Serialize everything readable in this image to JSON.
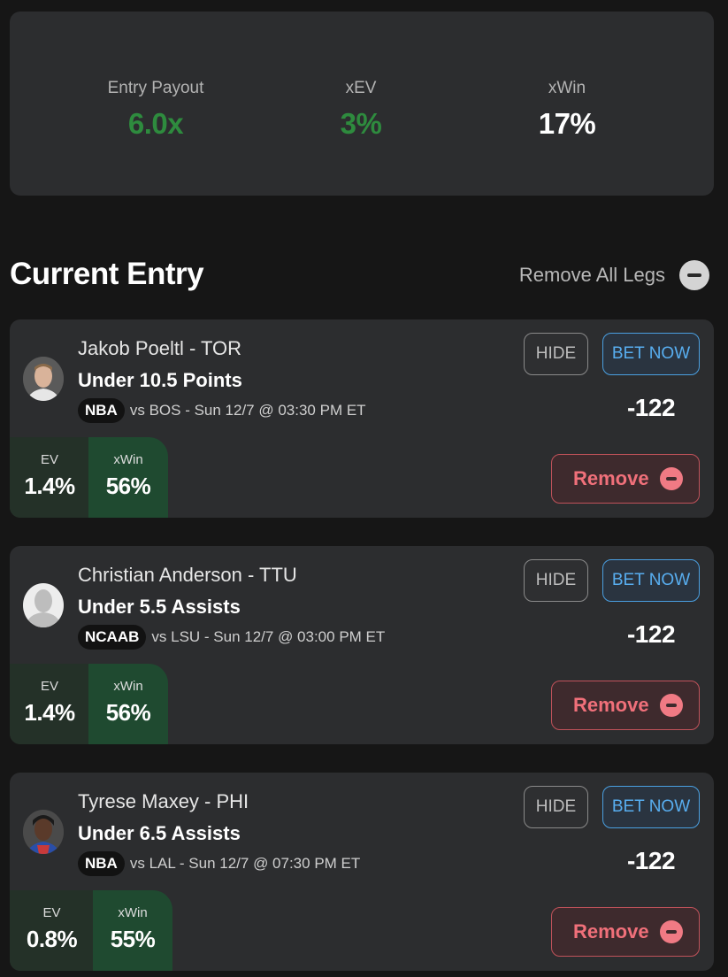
{
  "summary": {
    "entry_payout_label": "Entry Payout",
    "entry_payout_value": "6.0x",
    "xev_label": "xEV",
    "xev_value": "3%",
    "xwin_label": "xWin",
    "xwin_value": "17%"
  },
  "current_entry": {
    "title": "Current Entry",
    "remove_all_label": "Remove All Legs"
  },
  "legs": [
    {
      "player": "Jakob Poeltl - TOR",
      "prop": "Under 10.5 Points",
      "league": "NBA",
      "matchup": "vs BOS - Sun 12/7 @ 03:30 PM ET",
      "hide_label": "HIDE",
      "bet_label": "BET NOW",
      "odds": "-122",
      "ev_label": "EV",
      "ev_value": "1.4%",
      "xwin_label": "xWin",
      "xwin_value": "56%",
      "remove_label": "Remove"
    },
    {
      "player": "Christian Anderson - TTU",
      "prop": "Under 5.5 Assists",
      "league": "NCAAB",
      "matchup": "vs LSU - Sun 12/7 @ 03:00 PM ET",
      "hide_label": "HIDE",
      "bet_label": "BET NOW",
      "odds": "-122",
      "ev_label": "EV",
      "ev_value": "1.4%",
      "xwin_label": "xWin",
      "xwin_value": "56%",
      "remove_label": "Remove"
    },
    {
      "player": "Tyrese Maxey - PHI",
      "prop": "Under 6.5 Assists",
      "league": "NBA",
      "matchup": "vs LAL - Sun 12/7 @ 07:30 PM ET",
      "hide_label": "HIDE",
      "bet_label": "BET NOW",
      "odds": "-122",
      "ev_label": "EV",
      "ev_value": "0.8%",
      "xwin_label": "xWin",
      "xwin_value": "55%",
      "remove_label": "Remove"
    }
  ],
  "colors": {
    "background": "#161616",
    "card": "#2c2d2f",
    "positive_green": "#2e8b3e",
    "bet_blue": "#58aef0",
    "remove_red": "#f0707a",
    "xwin_box": "#1f4a30"
  }
}
